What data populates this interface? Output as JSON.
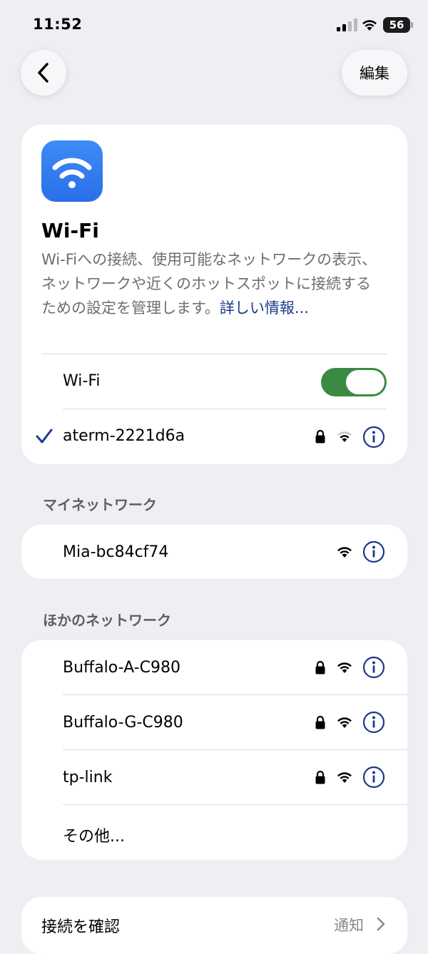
{
  "status_bar": {
    "time": "11:52",
    "battery": "56"
  },
  "nav": {
    "edit_label": "編集"
  },
  "wifi_card": {
    "title": "Wi-Fi",
    "description": "Wi-Fiへの接続、使用可能なネットワークの表示、ネットワークや近くのホットスポットに接続するための設定を管理します。",
    "more_link": "詳しい情報...",
    "toggle_label": "Wi-Fi",
    "toggle_on": true,
    "connected_network": "aterm-2221d6a"
  },
  "my_networks": {
    "title": "マイネットワーク",
    "items": [
      {
        "name": "Mia-bc84cf74",
        "locked": false
      }
    ]
  },
  "other_networks": {
    "title": "ほかのネットワーク",
    "items": [
      {
        "name": "Buffalo-A-C980",
        "locked": true
      },
      {
        "name": "Buffalo-G-C980",
        "locked": true
      },
      {
        "name": "tp-link",
        "locked": true
      }
    ],
    "other_label": "その他..."
  },
  "bottom_row": {
    "label": "接続を確認",
    "value": "通知"
  },
  "colors": {
    "accent": "#1b3a8c",
    "toggle_on": "#3a8a44",
    "background": "#efeef3"
  },
  "icons": [
    "back-chevron-icon",
    "wifi-app-icon",
    "checkmark-icon",
    "lock-icon",
    "wifi-signal-icon",
    "info-icon",
    "chevron-right-icon"
  ]
}
